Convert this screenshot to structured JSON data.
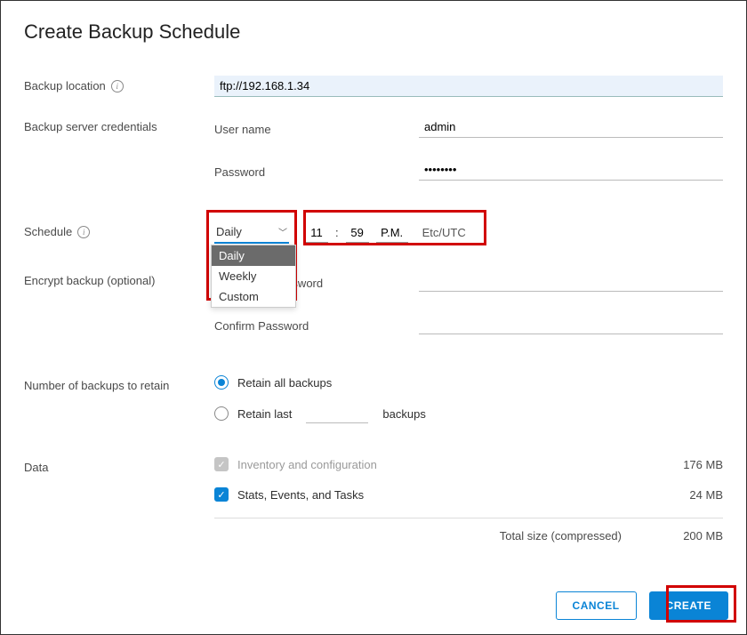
{
  "title": "Create Backup Schedule",
  "labels": {
    "backup_location": "Backup location",
    "backup_server_credentials": "Backup server credentials",
    "user_name": "User name",
    "password": "Password",
    "schedule": "Schedule",
    "encrypt_backup": "Encrypt backup (optional)",
    "encryption_password": "Encryption Password",
    "confirm_password": "Confirm Password",
    "number_of_backups": "Number of backups to retain",
    "retain_all": "Retain all backups",
    "retain_last_prefix": "Retain last",
    "retain_last_suffix": "backups",
    "data": "Data",
    "total_size": "Total size (compressed)"
  },
  "values": {
    "backup_location": "ftp://192.168.1.34",
    "user_name": "admin",
    "password": "••••••••",
    "schedule_frequency": "Daily",
    "hour": "11",
    "minute": "59",
    "ampm": "P.M.",
    "tz": "Etc/UTC",
    "retain_last_count": ""
  },
  "dropdown": {
    "options": [
      "Daily",
      "Weekly",
      "Custom"
    ],
    "selected": "Daily"
  },
  "radios": {
    "retain_all_checked": true,
    "retain_last_checked": false
  },
  "data_items": [
    {
      "label": "Inventory and configuration",
      "size": "176 MB",
      "checked": true,
      "disabled": true
    },
    {
      "label": "Stats, Events, and Tasks",
      "size": "24 MB",
      "checked": true,
      "disabled": false
    }
  ],
  "totals": {
    "size": "200 MB"
  },
  "buttons": {
    "cancel": "CANCEL",
    "create": "CREATE"
  }
}
